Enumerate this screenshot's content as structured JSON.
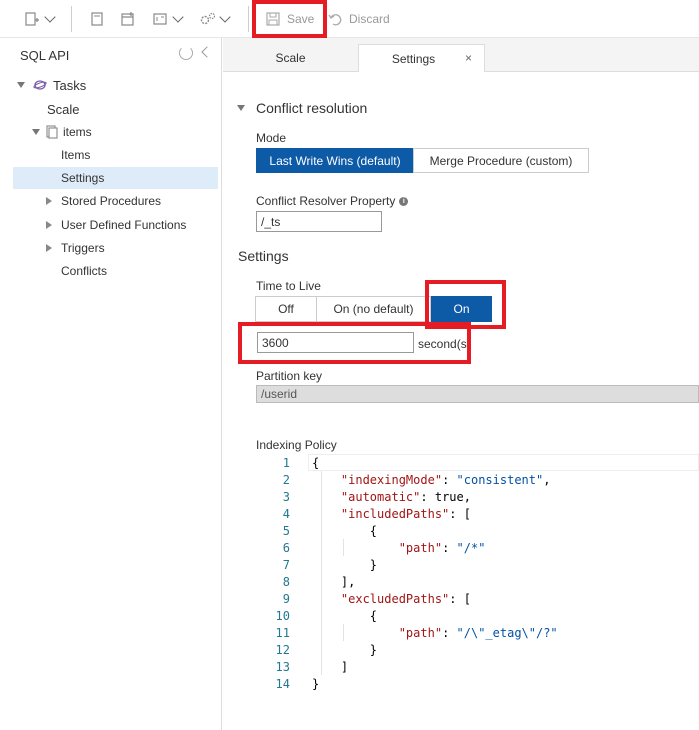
{
  "toolbar": {
    "save_label": "Save",
    "discard_label": "Discard"
  },
  "sidebar": {
    "title": "SQL API",
    "tree": {
      "database": "Tasks",
      "scale": "Scale",
      "container": "items",
      "items": "Items",
      "settings": "Settings",
      "stored_procedures": "Stored Procedures",
      "udfs": "User Defined Functions",
      "triggers": "Triggers",
      "conflicts": "Conflicts"
    }
  },
  "tabs": [
    {
      "label": "Scale",
      "active": false
    },
    {
      "label": "Settings",
      "active": true,
      "close": "×"
    }
  ],
  "conflict": {
    "section_title": "Conflict resolution",
    "mode_label": "Mode",
    "mode_options": [
      "Last Write Wins (default)",
      "Merge Procedure (custom)"
    ],
    "mode_selected": "Last Write Wins (default)",
    "resolver_label": "Conflict Resolver Property",
    "resolver_info": "i",
    "resolver_value": "/_ts"
  },
  "settings": {
    "section_title": "Settings",
    "ttl_label": "Time to Live",
    "ttl_options": [
      "Off",
      "On (no default)",
      "On"
    ],
    "ttl_selected": "On",
    "ttl_value": "3600",
    "ttl_unit": "second(s)",
    "partition_label": "Partition key",
    "partition_value": "/userid",
    "indexing_label": "Indexing Policy"
  },
  "indexing_policy_lines": [
    {
      "n": "1",
      "text": "{"
    },
    {
      "n": "2",
      "text": "    \"indexingMode\": \"consistent\","
    },
    {
      "n": "3",
      "text": "    \"automatic\": true,"
    },
    {
      "n": "4",
      "text": "    \"includedPaths\": ["
    },
    {
      "n": "5",
      "text": "        {"
    },
    {
      "n": "6",
      "text": "            \"path\": \"/*\""
    },
    {
      "n": "7",
      "text": "        }"
    },
    {
      "n": "8",
      "text": "    ],"
    },
    {
      "n": "9",
      "text": "    \"excludedPaths\": ["
    },
    {
      "n": "10",
      "text": "        {"
    },
    {
      "n": "11",
      "text": "            \"path\": \"/\\\"_etag\\\"/?\""
    },
    {
      "n": "12",
      "text": "        }"
    },
    {
      "n": "13",
      "text": "    ]"
    },
    {
      "n": "14",
      "text": "}"
    }
  ],
  "colors": {
    "accent": "#0d5aa7",
    "highlight": "#e51c23",
    "selection": "#deecf9"
  }
}
